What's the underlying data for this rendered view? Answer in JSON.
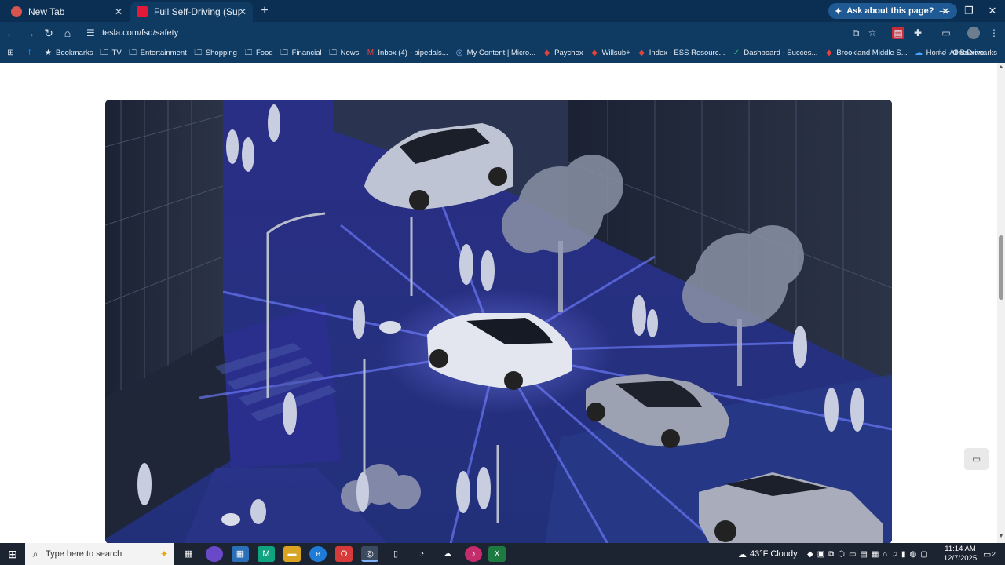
{
  "tabs": [
    {
      "title": "New Tab",
      "active": false
    },
    {
      "title": "Full Self-Driving (Supervised) V",
      "active": true
    }
  ],
  "ask_button": {
    "label": "Ask about this page?"
  },
  "address_bar": {
    "url": "tesla.com/fsd/safety"
  },
  "bookmarks": [
    {
      "label": "",
      "icon": "facebook-icon"
    },
    {
      "label": "Bookmarks",
      "icon": "star-icon"
    },
    {
      "label": "TV",
      "icon": "folder-icon"
    },
    {
      "label": "Entertainment",
      "icon": "folder-icon"
    },
    {
      "label": "Shopping",
      "icon": "folder-icon"
    },
    {
      "label": "Food",
      "icon": "folder-icon"
    },
    {
      "label": "Financial",
      "icon": "folder-icon"
    },
    {
      "label": "News",
      "icon": "folder-icon"
    },
    {
      "label": "Inbox (4) - bipedals...",
      "icon": "mail-icon"
    },
    {
      "label": "My Content | Micro...",
      "icon": "globe-icon"
    },
    {
      "label": "Paychex",
      "icon": "site-icon"
    },
    {
      "label": "Willsub+",
      "icon": "site-icon"
    },
    {
      "label": "Index - ESS Resourc...",
      "icon": "site-icon"
    },
    {
      "label": "Dashboard - Succes...",
      "icon": "check-icon"
    },
    {
      "label": "Brookland Middle S...",
      "icon": "site-icon"
    },
    {
      "label": "Home - OneDrive",
      "icon": "cloud-icon"
    }
  ],
  "all_bookmarks": {
    "label": "All Bookmarks"
  },
  "taskbar": {
    "search_placeholder": "Type here to search",
    "weather": "43°F  Cloudy",
    "time": "11:14 AM",
    "date": "12/7/2025",
    "notification_count": "2"
  },
  "colors": {
    "browser_bg": "#0f3b63",
    "tabstrip_bg": "#0b2f52",
    "hero_bg": "#1a2262",
    "accent_beam": "#5a6bff"
  }
}
